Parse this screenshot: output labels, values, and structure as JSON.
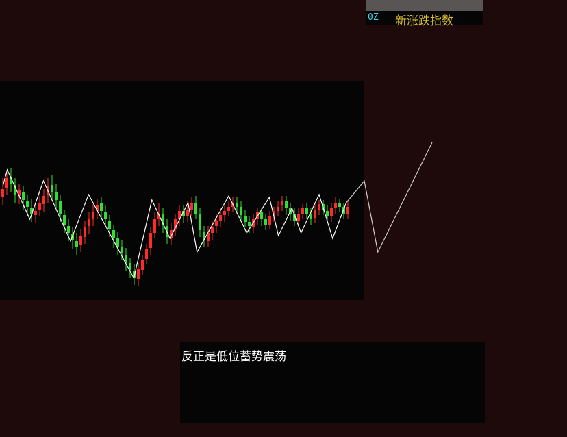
{
  "header": {
    "code": "0Z",
    "name": "新涨跌指数"
  },
  "comment": {
    "text": "反正是低位蓄势震荡"
  },
  "colors": {
    "background": "#1e0a0a",
    "panel": "#050505",
    "up": "#ff2a2a",
    "down": "#30e030",
    "zigzag": "#ffffff",
    "projection": "#cccccc"
  },
  "chart_data": {
    "type": "candlestick",
    "title": "",
    "xlabel": "",
    "ylabel": "",
    "x": [
      0,
      1,
      2,
      3,
      4,
      5,
      6,
      7,
      8,
      9,
      10,
      11,
      12,
      13,
      14,
      15,
      16,
      17,
      18,
      19,
      20,
      21,
      22,
      23,
      24,
      25,
      26,
      27,
      28,
      29,
      30,
      31,
      32,
      33,
      34,
      35,
      36,
      37,
      38,
      39,
      40,
      41,
      42,
      43,
      44,
      45,
      46,
      47,
      48,
      49,
      50,
      51,
      52,
      53,
      54,
      55,
      56,
      57,
      58,
      59,
      60,
      61,
      62,
      63,
      64,
      65,
      66,
      67,
      68,
      69,
      70,
      71,
      72,
      73,
      74,
      75,
      76,
      77,
      78,
      79,
      80,
      81,
      82,
      83,
      84
    ],
    "ylim": [
      0,
      100
    ],
    "candles": [
      {
        "o": 56,
        "c": 62,
        "h": 70,
        "l": 50
      },
      {
        "o": 63,
        "c": 70,
        "h": 74,
        "l": 58
      },
      {
        "o": 71,
        "c": 66,
        "h": 77,
        "l": 60
      },
      {
        "o": 65,
        "c": 58,
        "h": 70,
        "l": 52
      },
      {
        "o": 57,
        "c": 61,
        "h": 66,
        "l": 51
      },
      {
        "o": 60,
        "c": 54,
        "h": 64,
        "l": 47
      },
      {
        "o": 53,
        "c": 49,
        "h": 58,
        "l": 42
      },
      {
        "o": 48,
        "c": 44,
        "h": 55,
        "l": 38
      },
      {
        "o": 43,
        "c": 46,
        "h": 52,
        "l": 37
      },
      {
        "o": 47,
        "c": 52,
        "h": 57,
        "l": 42
      },
      {
        "o": 51,
        "c": 57,
        "h": 62,
        "l": 45
      },
      {
        "o": 58,
        "c": 64,
        "h": 70,
        "l": 52
      },
      {
        "o": 65,
        "c": 60,
        "h": 72,
        "l": 55
      },
      {
        "o": 60,
        "c": 54,
        "h": 66,
        "l": 48
      },
      {
        "o": 53,
        "c": 44,
        "h": 58,
        "l": 38
      },
      {
        "o": 43,
        "c": 36,
        "h": 47,
        "l": 30
      },
      {
        "o": 35,
        "c": 30,
        "h": 40,
        "l": 24
      },
      {
        "o": 29,
        "c": 25,
        "h": 34,
        "l": 18
      },
      {
        "o": 24,
        "c": 20,
        "h": 30,
        "l": 14
      },
      {
        "o": 21,
        "c": 28,
        "h": 33,
        "l": 16
      },
      {
        "o": 27,
        "c": 34,
        "h": 39,
        "l": 22
      },
      {
        "o": 35,
        "c": 40,
        "h": 45,
        "l": 29
      },
      {
        "o": 40,
        "c": 45,
        "h": 51,
        "l": 35
      },
      {
        "o": 46,
        "c": 50,
        "h": 55,
        "l": 40
      },
      {
        "o": 52,
        "c": 46,
        "h": 56,
        "l": 40
      },
      {
        "o": 45,
        "c": 40,
        "h": 50,
        "l": 34
      },
      {
        "o": 39,
        "c": 33,
        "h": 43,
        "l": 27
      },
      {
        "o": 32,
        "c": 26,
        "h": 36,
        "l": 19
      },
      {
        "o": 26,
        "c": 20,
        "h": 31,
        "l": 14
      },
      {
        "o": 20,
        "c": 15,
        "h": 25,
        "l": 10
      },
      {
        "o": 14,
        "c": 8,
        "h": 19,
        "l": 2
      },
      {
        "o": 8,
        "c": 3,
        "h": 12,
        "l": -3
      },
      {
        "o": 2,
        "c": -3,
        "h": 7,
        "l": -8
      },
      {
        "o": -4,
        "c": 4,
        "h": 8,
        "l": -9
      },
      {
        "o": 3,
        "c": 10,
        "h": 14,
        "l": -1
      },
      {
        "o": 11,
        "c": 18,
        "h": 22,
        "l": 7
      },
      {
        "o": 19,
        "c": 30,
        "h": 34,
        "l": 14
      },
      {
        "o": 30,
        "c": 40,
        "h": 45,
        "l": 26
      },
      {
        "o": 40,
        "c": 44,
        "h": 52,
        "l": 35
      },
      {
        "o": 44,
        "c": 36,
        "h": 48,
        "l": 30
      },
      {
        "o": 35,
        "c": 27,
        "h": 40,
        "l": 22
      },
      {
        "o": 26,
        "c": 32,
        "h": 37,
        "l": 21
      },
      {
        "o": 33,
        "c": 40,
        "h": 44,
        "l": 28
      },
      {
        "o": 40,
        "c": 46,
        "h": 50,
        "l": 35
      },
      {
        "o": 46,
        "c": 42,
        "h": 50,
        "l": 37
      },
      {
        "o": 42,
        "c": 47,
        "h": 53,
        "l": 38
      },
      {
        "o": 47,
        "c": 52,
        "h": 56,
        "l": 42
      },
      {
        "o": 52,
        "c": 44,
        "h": 57,
        "l": 40
      },
      {
        "o": 44,
        "c": 32,
        "h": 48,
        "l": 27
      },
      {
        "o": 31,
        "c": 25,
        "h": 35,
        "l": 20
      },
      {
        "o": 24,
        "c": 30,
        "h": 35,
        "l": 20
      },
      {
        "o": 30,
        "c": 34,
        "h": 39,
        "l": 25
      },
      {
        "o": 35,
        "c": 39,
        "h": 44,
        "l": 30
      },
      {
        "o": 39,
        "c": 43,
        "h": 48,
        "l": 34
      },
      {
        "o": 43,
        "c": 46,
        "h": 50,
        "l": 38
      },
      {
        "o": 46,
        "c": 49,
        "h": 53,
        "l": 42
      },
      {
        "o": 49,
        "c": 52,
        "h": 56,
        "l": 45
      },
      {
        "o": 52,
        "c": 49,
        "h": 56,
        "l": 44
      },
      {
        "o": 49,
        "c": 43,
        "h": 53,
        "l": 39
      },
      {
        "o": 42,
        "c": 38,
        "h": 47,
        "l": 34
      },
      {
        "o": 38,
        "c": 35,
        "h": 42,
        "l": 30
      },
      {
        "o": 34,
        "c": 40,
        "h": 44,
        "l": 30
      },
      {
        "o": 40,
        "c": 45,
        "h": 48,
        "l": 36
      },
      {
        "o": 45,
        "c": 40,
        "h": 48,
        "l": 35
      },
      {
        "o": 40,
        "c": 36,
        "h": 44,
        "l": 32
      },
      {
        "o": 36,
        "c": 42,
        "h": 46,
        "l": 33
      },
      {
        "o": 42,
        "c": 46,
        "h": 49,
        "l": 38
      },
      {
        "o": 46,
        "c": 49,
        "h": 53,
        "l": 42
      },
      {
        "o": 50,
        "c": 53,
        "h": 57,
        "l": 46
      },
      {
        "o": 53,
        "c": 48,
        "h": 57,
        "l": 43
      },
      {
        "o": 48,
        "c": 44,
        "h": 52,
        "l": 39
      },
      {
        "o": 44,
        "c": 39,
        "h": 48,
        "l": 35
      },
      {
        "o": 39,
        "c": 44,
        "h": 48,
        "l": 35
      },
      {
        "o": 44,
        "c": 48,
        "h": 51,
        "l": 40
      },
      {
        "o": 48,
        "c": 44,
        "h": 52,
        "l": 40
      },
      {
        "o": 44,
        "c": 40,
        "h": 48,
        "l": 36
      },
      {
        "o": 41,
        "c": 47,
        "h": 51,
        "l": 37
      },
      {
        "o": 47,
        "c": 51,
        "h": 54,
        "l": 43
      },
      {
        "o": 51,
        "c": 47,
        "h": 54,
        "l": 43
      },
      {
        "o": 46,
        "c": 42,
        "h": 50,
        "l": 38
      },
      {
        "o": 42,
        "c": 48,
        "h": 52,
        "l": 38
      },
      {
        "o": 48,
        "c": 52,
        "h": 56,
        "l": 44
      },
      {
        "o": 52,
        "c": 49,
        "h": 55,
        "l": 45
      },
      {
        "o": 49,
        "c": 44,
        "h": 52,
        "l": 40
      },
      {
        "o": 44,
        "c": 49,
        "h": 53,
        "l": 40
      }
    ],
    "zigzag": [
      [
        0,
        64
      ],
      [
        2,
        76
      ],
      [
        12,
        40
      ],
      [
        18,
        68
      ],
      [
        30,
        24
      ],
      [
        38,
        58
      ],
      [
        58,
        -3
      ],
      [
        66,
        54
      ],
      [
        74,
        26
      ],
      [
        82,
        52
      ],
      [
        86,
        16
      ],
      [
        100,
        57
      ],
      [
        108,
        30
      ],
      [
        118,
        56
      ],
      [
        122,
        28
      ],
      [
        128,
        48
      ],
      [
        132,
        30
      ],
      [
        140,
        58
      ],
      [
        146,
        26
      ],
      [
        152,
        52
      ]
    ],
    "projection": [
      [
        152,
        52
      ],
      [
        160,
        68
      ],
      [
        166,
        16
      ],
      [
        190,
        96
      ]
    ]
  }
}
